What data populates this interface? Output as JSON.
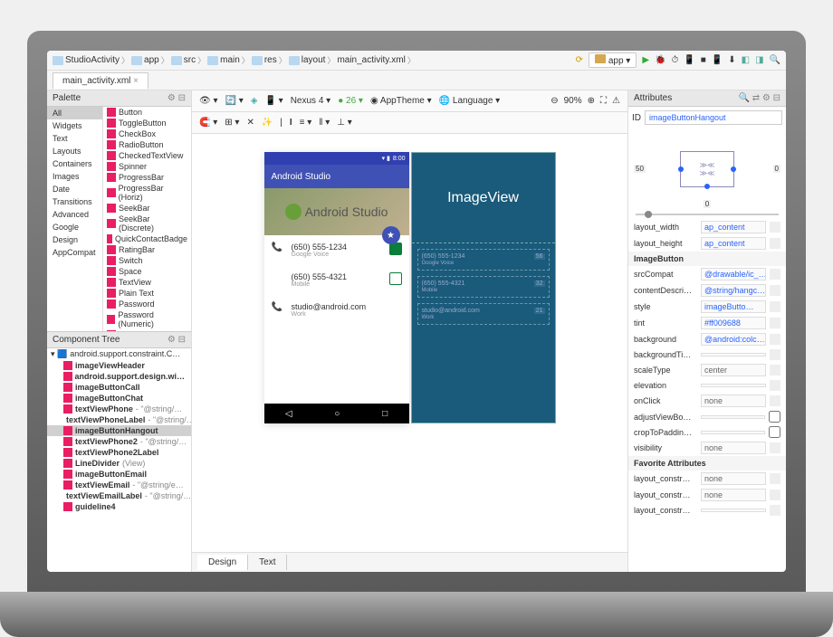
{
  "breadcrumb": {
    "items": [
      "StudioActivity",
      "app",
      "src",
      "main",
      "res",
      "layout",
      "main_activity.xml"
    ],
    "run_config": "app"
  },
  "editor_tab": "main_activity.xml",
  "palette": {
    "title": "Palette",
    "categories": [
      "All",
      "Widgets",
      "Text",
      "Layouts",
      "Containers",
      "Images",
      "Date",
      "Transitions",
      "Advanced",
      "Google",
      "Design",
      "AppCompat"
    ],
    "items": [
      "Button",
      "ToggleButton",
      "CheckBox",
      "RadioButton",
      "CheckedTextView",
      "Spinner",
      "ProgressBar",
      "ProgressBar (Horiz)",
      "SeekBar",
      "SeekBar (Discrete)",
      "QuickContactBadge",
      "RatingBar",
      "Switch",
      "Space",
      "TextView",
      "Plain Text",
      "Password",
      "Password (Numeric)",
      "E-mail"
    ]
  },
  "tree": {
    "title": "Component Tree",
    "root": "android.support.constraint.C…",
    "items": [
      {
        "name": "imageViewHeader",
        "extra": ""
      },
      {
        "name": "android.support.design.wi…",
        "extra": ""
      },
      {
        "name": "imageButtonCall",
        "extra": ""
      },
      {
        "name": "imageButtonChat",
        "extra": ""
      },
      {
        "name": "textViewPhone",
        "extra": "- \"@string/…"
      },
      {
        "name": "textViewPhoneLabel",
        "extra": "- \"@string/…"
      },
      {
        "name": "imageButtonHangout",
        "extra": "",
        "selected": true
      },
      {
        "name": "textViewPhone2",
        "extra": "- \"@string/…"
      },
      {
        "name": "textViewPhone2Label",
        "extra": ""
      },
      {
        "name": "LineDivider",
        "extra": "(View)"
      },
      {
        "name": "imageButtonEmail",
        "extra": ""
      },
      {
        "name": "textViewEmail",
        "extra": "- \"@string/e…"
      },
      {
        "name": "textViewEmailLabel",
        "extra": "- \"@string/…"
      },
      {
        "name": "guideline4",
        "extra": ""
      }
    ]
  },
  "toolbar": {
    "device": "Nexus 4",
    "api": "26",
    "theme": "AppTheme",
    "lang": "Language",
    "zoom": "90%"
  },
  "preview": {
    "status_time": "8:00",
    "app_title": "Android Studio",
    "header_text": "Android Studio",
    "blueprint_label": "ImageView",
    "rows": [
      {
        "icon": "phone",
        "main": "(650) 555-1234",
        "sub": "Google Voice",
        "action": "chat-fill"
      },
      {
        "icon": "",
        "main": "(650) 555-4321",
        "sub": "Mobile",
        "action": "chat-out"
      },
      {
        "icon": "phone",
        "main": "studio@android.com",
        "sub": "Work",
        "action": ""
      }
    ],
    "blue_rows": [
      {
        "main": "(650) 555-1234",
        "sub": "Google Voice",
        "w": "56"
      },
      {
        "main": "(650) 555-4321",
        "sub": "Mobile",
        "w": "32"
      },
      {
        "main": "studio@android.com",
        "sub": "Work",
        "w": "21"
      }
    ]
  },
  "attributes": {
    "title": "Attributes",
    "id_label": "ID",
    "id_value": "imageButtonHangout",
    "constraint_left": "50",
    "constraint_right": "0",
    "constraint_bottom": "0",
    "layout_width": {
      "k": "layout_width",
      "v": "ap_content"
    },
    "layout_height": {
      "k": "layout_height",
      "v": "ap_content"
    },
    "section": "ImageButton",
    "rows": [
      {
        "k": "srcCompat",
        "v": "@drawable/ic_…",
        "link": true
      },
      {
        "k": "contentDescri…",
        "v": "@string/hangc…",
        "link": true
      },
      {
        "k": "style",
        "v": "imageButto…",
        "link": true
      },
      {
        "k": "tint",
        "v": "#ff009688",
        "link": true
      },
      {
        "k": "background",
        "v": "@android:colc…",
        "link": true
      },
      {
        "k": "backgroundTi…",
        "v": "",
        "link": false
      },
      {
        "k": "scaleType",
        "v": "center",
        "link": false
      },
      {
        "k": "elevation",
        "v": "",
        "link": false
      },
      {
        "k": "onClick",
        "v": "none",
        "link": false
      },
      {
        "k": "adjustViewBo…",
        "v": "",
        "link": false,
        "check": true
      },
      {
        "k": "cropToPaddin…",
        "v": "",
        "link": false,
        "check": true
      },
      {
        "k": "visibility",
        "v": "none",
        "link": false
      }
    ],
    "fav_section": "Favorite Attributes",
    "fav_rows": [
      {
        "k": "layout_constr…",
        "v": "none"
      },
      {
        "k": "layout_constr…",
        "v": "none"
      },
      {
        "k": "layout_constr…",
        "v": ""
      }
    ]
  },
  "bottom_tabs": {
    "design": "Design",
    "text": "Text"
  }
}
